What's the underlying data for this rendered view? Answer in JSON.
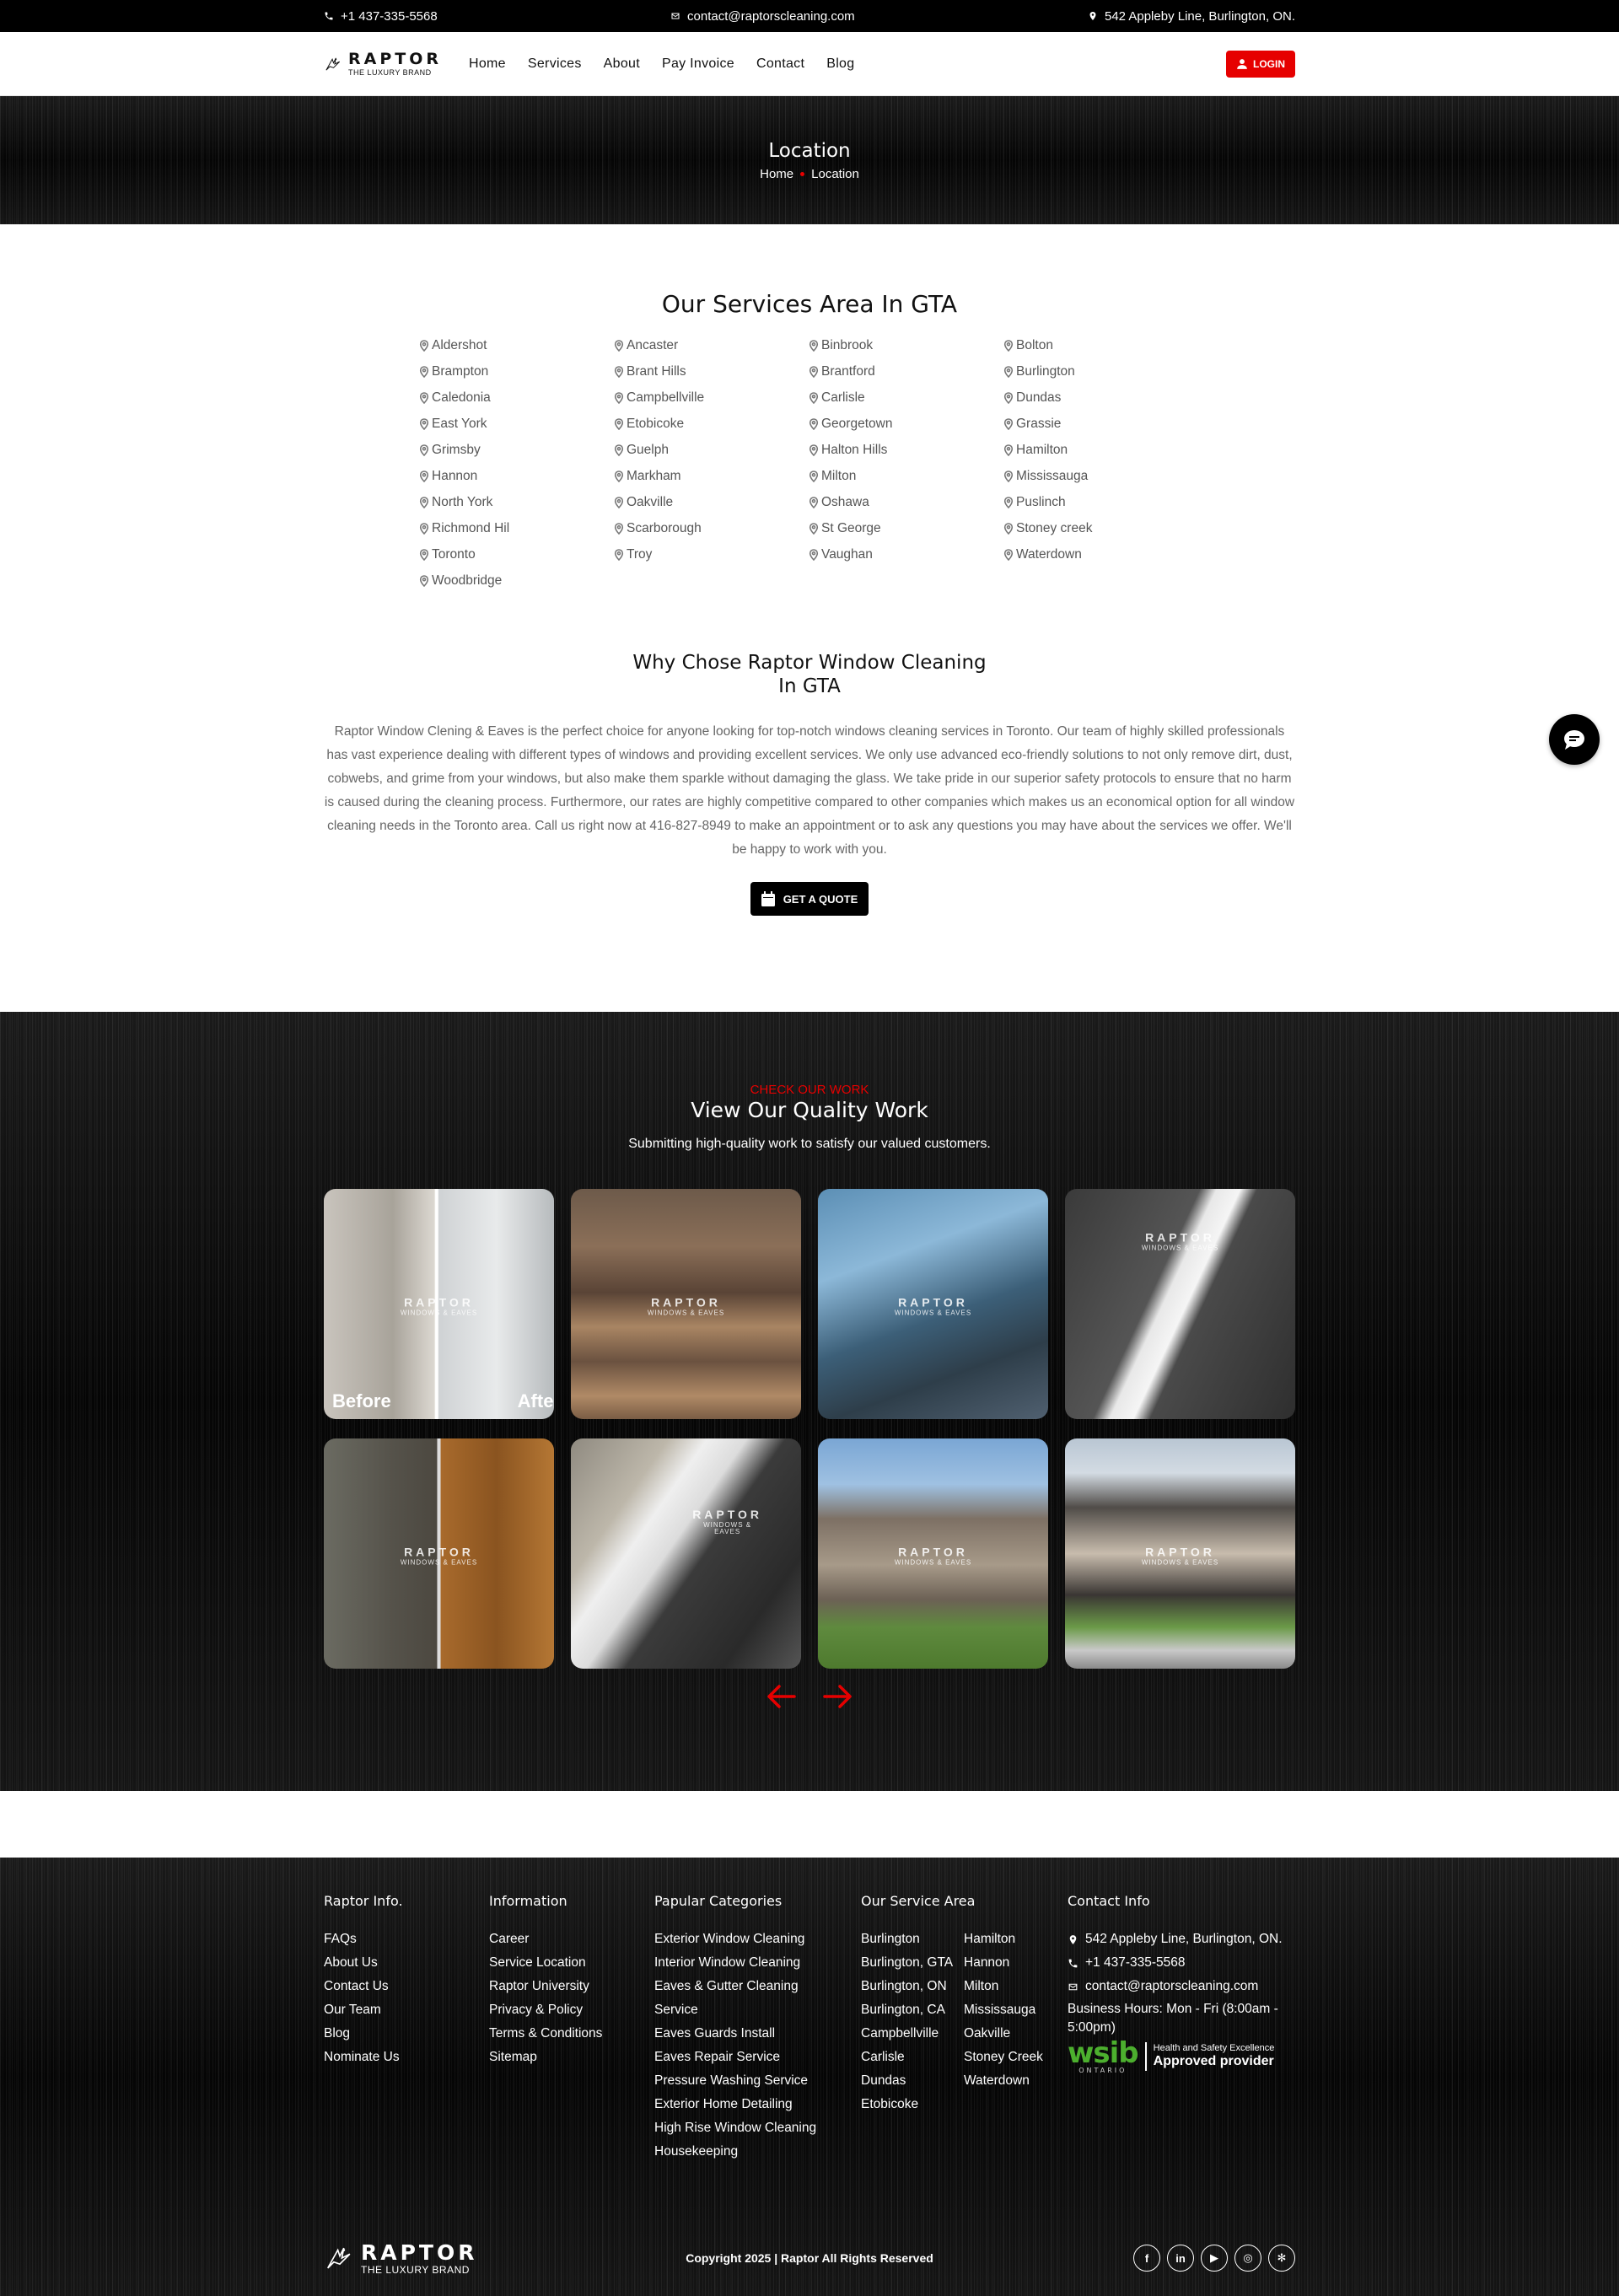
{
  "topbar": {
    "phone": "+1 437-335-5568",
    "email": "contact@raptorscleaning.com",
    "address": "542 Appleby Line, Burlington, ON."
  },
  "nav": {
    "logo_title": "RAPTOR",
    "logo_tagline": "THE LUXURY BRAND",
    "items": [
      "Home",
      "Services",
      "About",
      "Pay Invoice",
      "Contact",
      "Blog"
    ],
    "login_label": "LOGIN"
  },
  "hero": {
    "title": "Location",
    "breadcrumb_home": "Home",
    "breadcrumb_current": "Location"
  },
  "services": {
    "title": "Our Services Area In GTA",
    "locations": [
      "Aldershot",
      "Ancaster",
      "Binbrook",
      "Bolton",
      "Brampton",
      "Brant Hills",
      "Brantford",
      "Burlington",
      "Caledonia",
      "Campbellville",
      "Carlisle",
      "Dundas",
      "East York",
      "Etobicoke",
      "Georgetown",
      "Grassie",
      "Grimsby",
      "Guelph",
      "Halton Hills",
      "Hamilton",
      "Hannon",
      "Markham",
      "Milton",
      "Mississauga",
      "North York",
      "Oakville",
      "Oshawa",
      "Puslinch",
      "Richmond Hil",
      "Scarborough",
      "St George",
      "Stoney creek",
      "Toronto",
      "Troy",
      "Vaughan",
      "Waterdown",
      "Woodbridge"
    ]
  },
  "why": {
    "title": "Why Chose Raptor Window Cleaning In GTA",
    "body": "Raptor Window Clening & Eaves is the perfect choice for anyone looking for top-notch windows cleaning services in Toronto. Our team of highly skilled professionals has vast experience dealing with different types of windows and providing excellent services. We only use advanced eco-friendly solutions to not only remove dirt, dust, cobwebs, and grime from your windows, but also make them sparkle without damaging the glass. We take pride in our superior safety protocols to ensure that no harm is caused during the cleaning process. Furthermore, our rates are highly competitive compared to other companies which makes us an economical option for all window cleaning needs in the Toronto area. Call us right now at 416-827-8949 to make an appointment or to ask any questions you may have about the services we offer. We'll be happy to work with you.",
    "cta_label": "GET A QUOTE"
  },
  "work": {
    "eyebrow": "CHECK OUR WORK",
    "title": "View Our Quality Work",
    "subtitle": "Submitting high-quality work to satisfy our valued customers.",
    "watermark_title": "RAPTOR",
    "watermark_sub": "WINDOWS & EAVES",
    "before_label": "Before",
    "after_label": "After",
    "tiles": [
      "window-track-before-after",
      "brick-front-steps",
      "gutter-pressure-washing",
      "gutter-guard-on-roof",
      "deck-before-after",
      "gutter-guard-panel",
      "house-backyard-ladder",
      "modern-house-front"
    ]
  },
  "footer": {
    "col1": {
      "title": "Raptor Info.",
      "links": [
        "FAQs",
        "About Us",
        "Contact Us",
        "Our Team",
        "Blog",
        "Nominate Us"
      ]
    },
    "col2": {
      "title": "Information",
      "links": [
        "Career",
        "Service Location",
        "Raptor University",
        "Privacy & Policy",
        "Terms & Conditions",
        "Sitemap"
      ]
    },
    "col3": {
      "title": "Papular Categories",
      "links": [
        "Exterior Window Cleaning",
        "Interior Window Cleaning",
        "Eaves & Gutter Cleaning Service",
        "Eaves Guards Install",
        "Eaves Repair Service",
        "Pressure Washing Service",
        "Exterior Home Detailing",
        "High Rise Window Cleaning",
        "Housekeeping"
      ]
    },
    "col4": {
      "title": "Our Service Area",
      "left": [
        "Burlington",
        "Burlington, GTA",
        "Burlington, ON",
        "Burlington, CA",
        "Campbellville",
        "Carlisle",
        "Dundas",
        "Etobicoke"
      ],
      "right": [
        "Hamilton",
        "Hannon",
        "Milton",
        "Mississauga",
        "Oakville",
        "Stoney Creek",
        "Waterdown"
      ]
    },
    "col5": {
      "title": "Contact Info",
      "address": "542 Appleby Line, Burlington, ON.",
      "phone": "+1 437-335-5568",
      "email": "contact@raptorscleaning.com",
      "hours": "Business Hours: Mon - Fri (8:00am - 5:00pm)",
      "wsib_logo": "wsib",
      "wsib_region": "ONTARIO",
      "wsib_line1": "Health and Safety Excellence",
      "wsib_line2": "Approved provider"
    },
    "copyright": "Copyright 2025 | Raptor All Rights Reserved",
    "socials": [
      "facebook-icon",
      "linkedin-icon",
      "youtube-icon",
      "instagram-icon",
      "yelp-icon"
    ]
  },
  "colors": {
    "accent": "#e60000",
    "dark": "#0c0c0c",
    "wsib_green": "#4caf2e"
  }
}
